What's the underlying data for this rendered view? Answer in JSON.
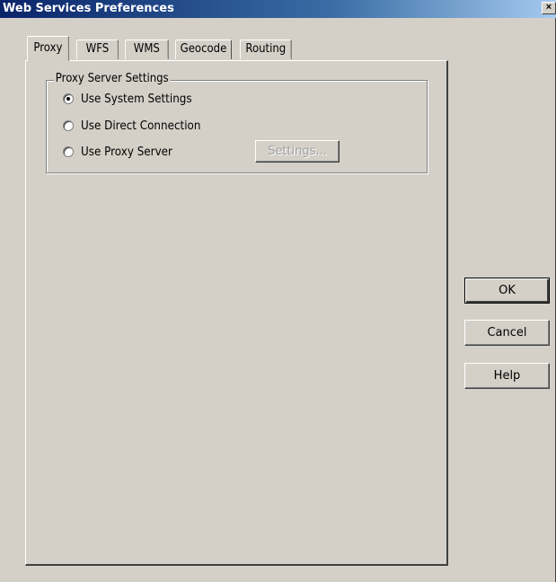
{
  "window": {
    "title": "Web Services Preferences",
    "close_glyph": "×"
  },
  "tabs": [
    {
      "label": "Proxy",
      "active": true
    },
    {
      "label": "WFS",
      "active": false
    },
    {
      "label": "WMS",
      "active": false
    },
    {
      "label": "Geocode",
      "active": false
    },
    {
      "label": "Routing",
      "active": false
    }
  ],
  "proxy_group": {
    "label": "Proxy Server Settings",
    "options": [
      {
        "label": "Use System Settings",
        "selected": true
      },
      {
        "label": "Use Direct Connection",
        "selected": false
      },
      {
        "label": "Use Proxy Server",
        "selected": false
      }
    ],
    "settings_button": {
      "label": "Settings...",
      "enabled": false
    }
  },
  "buttons": {
    "ok": "OK",
    "cancel": "Cancel",
    "help": "Help"
  },
  "colors": {
    "face": "#d4d0c8",
    "title_start": "#0a246a",
    "title_end": "#a6caf0"
  }
}
